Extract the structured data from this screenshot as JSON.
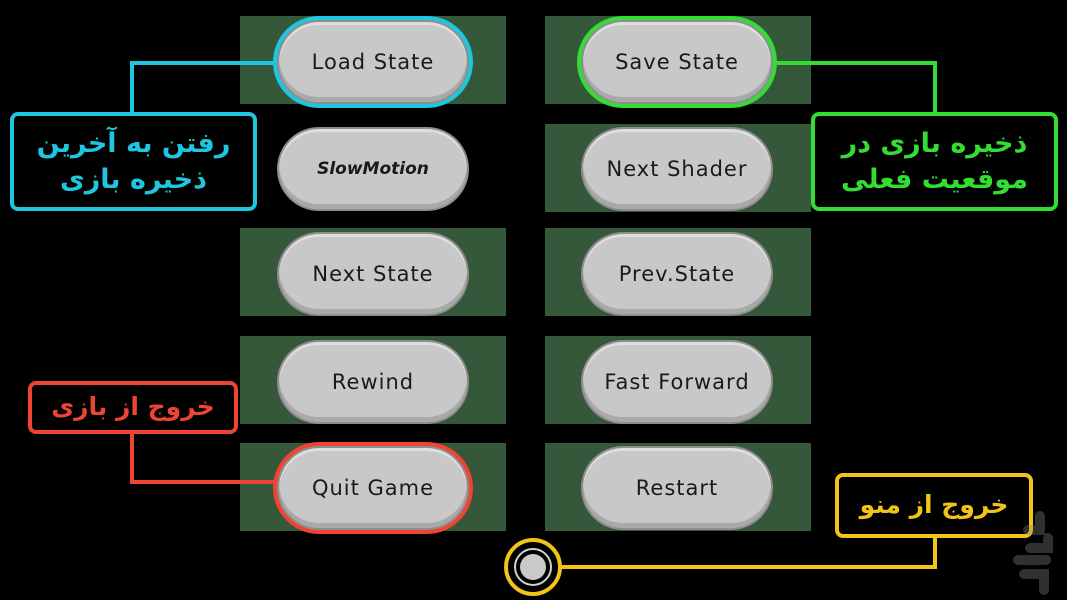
{
  "buttons": {
    "load_state": "Load State",
    "save_state": "Save State",
    "slow_motion": "SlowMotion",
    "next_shader": "Next Shader",
    "next_state": "Next State",
    "prev_state": "Prev.State",
    "rewind": "Rewind",
    "fast_forward": "Fast Forward",
    "quit_game": "Quit Game",
    "restart": "Restart"
  },
  "callouts": {
    "load_state": {
      "line1": "رفتن به آخرین",
      "line2": "ذخیره بازی",
      "color": "#1fc6e0"
    },
    "save_state": {
      "line1": "ذخیره بازی در",
      "line2": "موقعیت فعلی",
      "color": "#33dd33"
    },
    "quit_game": {
      "text": "خروج از بازی",
      "color": "#ee4433"
    },
    "exit_menu": {
      "text": "خروج از منو",
      "color": "#f0c419"
    }
  },
  "colors": {
    "panel": "#35573a",
    "button": "#c8c8c8"
  },
  "icons": {
    "menu_toggle": "circle-button-icon",
    "watermark": "cafebazaar-logo-icon"
  }
}
